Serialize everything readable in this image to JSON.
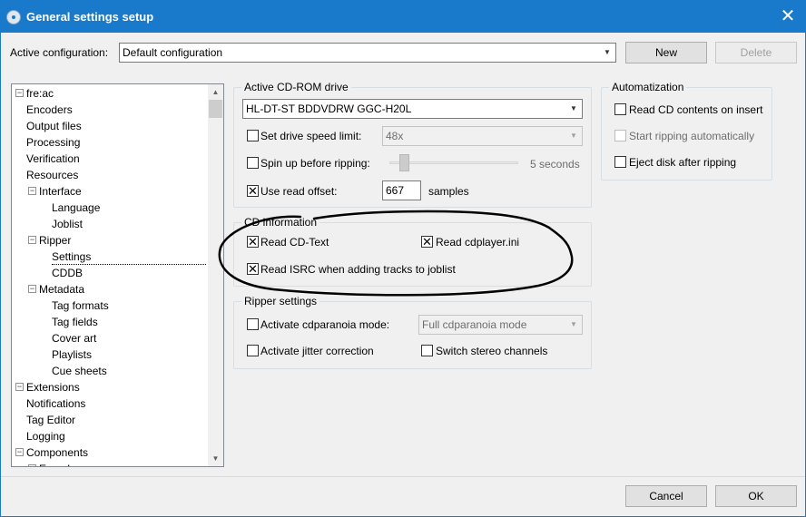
{
  "window": {
    "title": "General settings setup",
    "close_glyph": "✕"
  },
  "config": {
    "label": "Active configuration:",
    "value": "Default configuration",
    "new_label": "New",
    "delete_label": "Delete"
  },
  "tree": {
    "items": [
      {
        "label": "fre:ac",
        "expander": "−"
      },
      {
        "label": "Encoders"
      },
      {
        "label": "Output files"
      },
      {
        "label": "Processing"
      },
      {
        "label": "Verification"
      },
      {
        "label": "Resources"
      },
      {
        "label": "Interface",
        "expander": "−"
      },
      {
        "label": "Language"
      },
      {
        "label": "Joblist"
      },
      {
        "label": "Ripper",
        "expander": "−"
      },
      {
        "label": "Settings",
        "selected": true
      },
      {
        "label": "CDDB"
      },
      {
        "label": "Metadata",
        "expander": "−"
      },
      {
        "label": "Tag formats"
      },
      {
        "label": "Tag fields"
      },
      {
        "label": "Cover art"
      },
      {
        "label": "Playlists"
      },
      {
        "label": "Cue sheets"
      },
      {
        "label": "Extensions",
        "expander": "−"
      },
      {
        "label": "Notifications"
      },
      {
        "label": "Tag Editor"
      },
      {
        "label": "Logging"
      },
      {
        "label": "Components",
        "expander": "−"
      },
      {
        "label": "Encod",
        "expander": "−"
      }
    ]
  },
  "cdrom": {
    "title": "Active CD-ROM drive",
    "drive": "HL-DT-ST BDDVDRW GGC-H20L",
    "speed_label": "Set drive speed limit:",
    "speed_checked": false,
    "speed_value": "48x",
    "spinup_label": "Spin up before ripping:",
    "spinup_checked": false,
    "spinup_seconds": "5 seconds",
    "spinup_level": 0.08,
    "offset_label": "Use read offset:",
    "offset_checked": true,
    "offset_value": "667",
    "offset_unit": "samples"
  },
  "automatization": {
    "title": "Automatization",
    "read_on_insert": "Read CD contents on insert",
    "start_ripping": "Start ripping automatically",
    "eject": "Eject disk after ripping"
  },
  "cdinfo": {
    "title": "CD information",
    "cdtext": "Read CD-Text",
    "cdplayer": "Read cdplayer.ini",
    "isrc": "Read ISRC when adding tracks to joblist"
  },
  "ripper": {
    "title": "Ripper settings",
    "paranoia_label": "Activate cdparanoia mode:",
    "paranoia_mode": "Full cdparanoia mode",
    "jitter": "Activate jitter correction",
    "stereo": "Switch stereo channels"
  },
  "footer": {
    "cancel_label": "Cancel",
    "ok_label": "OK"
  },
  "glyphs": {
    "check": "✕",
    "combo_arrow": "▼",
    "scroll_up": "▲",
    "scroll_down": "▼"
  },
  "colors": {
    "titlebar": "#1979ca",
    "annotation": "#000000"
  }
}
